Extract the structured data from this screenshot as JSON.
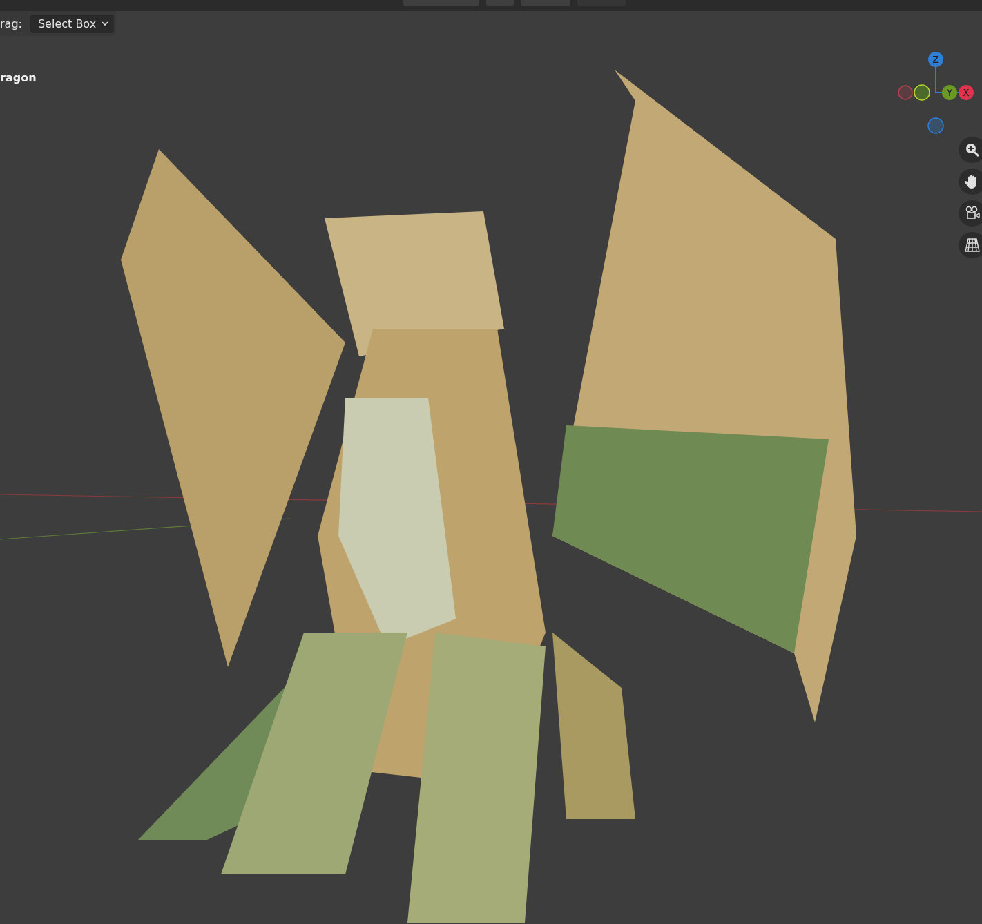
{
  "tool_settings": {
    "drag_label": "rag:",
    "drag_value": "Select Box"
  },
  "viewport": {
    "object_name": "ragon"
  },
  "gizmo": {
    "axes": [
      {
        "label": "Z",
        "kind": "z"
      },
      {
        "label": "Y",
        "kind": "y"
      },
      {
        "label": "X",
        "kind": "x"
      }
    ]
  }
}
